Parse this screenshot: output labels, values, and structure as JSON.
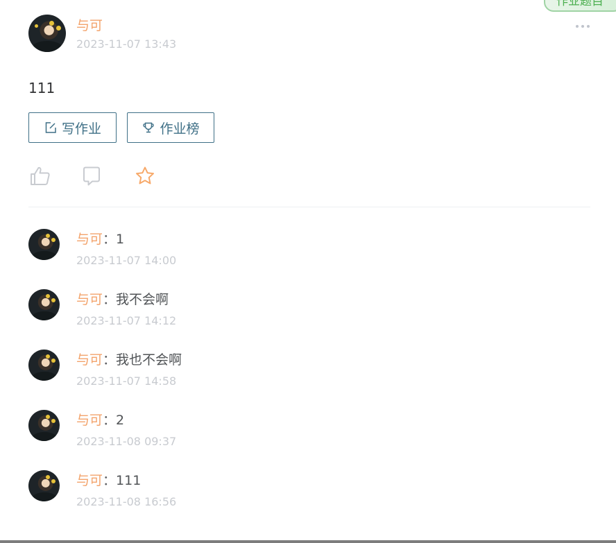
{
  "top_tag": {
    "label": "作业题目"
  },
  "post": {
    "author": "与可",
    "time": "2023-11-07 13:43",
    "content": "111",
    "buttons": {
      "write_label": "写作业",
      "rank_label": "作业榜"
    },
    "icons": [
      "like-icon",
      "comment-icon",
      "star-icon",
      "more-icon"
    ]
  },
  "comments": [
    {
      "author": "与可",
      "sep": "：",
      "text": "1",
      "time": "2023-11-07 14:00"
    },
    {
      "author": "与可",
      "sep": "：",
      "text": "我不会啊",
      "time": "2023-11-07 14:12"
    },
    {
      "author": "与可",
      "sep": "：",
      "text": "我也不会啊",
      "time": "2023-11-07 14:58"
    },
    {
      "author": "与可",
      "sep": "：",
      "text": "2",
      "time": "2023-11-08 09:37"
    },
    {
      "author": "与可",
      "sep": "：",
      "text": "111",
      "time": "2023-11-08 16:56"
    }
  ],
  "colors": {
    "author": "#f3a36b",
    "time": "#c8cbd0",
    "button_border": "#3e6f86",
    "star": "#f7a96a",
    "tag_green": "#4caf50"
  }
}
